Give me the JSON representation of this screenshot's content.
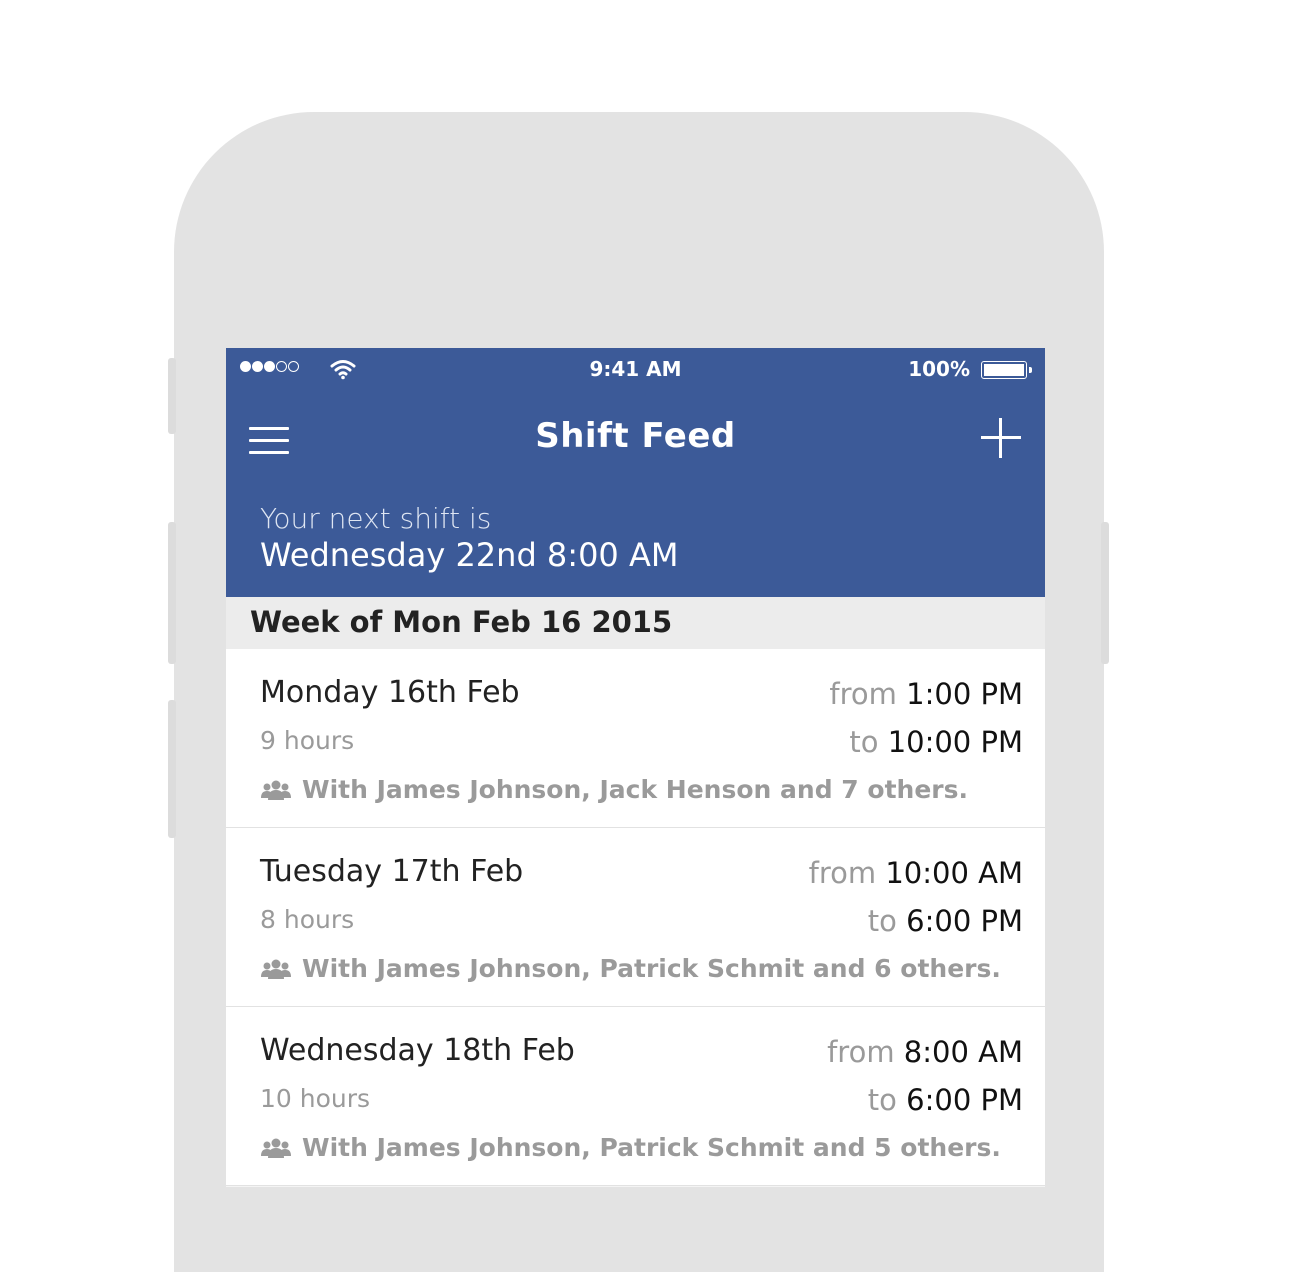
{
  "status_bar": {
    "signal_filled": 3,
    "signal_total": 5,
    "time": "9:41 AM",
    "battery_percent": "100%"
  },
  "nav": {
    "title": "Shift Feed",
    "menu_icon": "hamburger-menu-icon",
    "add_icon": "plus-icon"
  },
  "next_shift": {
    "label": "Your next shift is",
    "value": "Wednesday 22nd 8:00 AM"
  },
  "week": {
    "label": "Week of Mon Feb 16 2015"
  },
  "shifts": [
    {
      "day": "Monday 16th Feb",
      "hours": "9 hours",
      "from_label": "from",
      "from_time": "1:00 PM",
      "to_label": "to",
      "to_time": "10:00 PM",
      "with": "With James Johnson, Jack Henson and 7 others."
    },
    {
      "day": "Tuesday 17th Feb",
      "hours": "8 hours",
      "from_label": "from",
      "from_time": "10:00 AM",
      "to_label": "to",
      "to_time": "6:00 PM",
      "with": "With James Johnson, Patrick Schmit and 6 others."
    },
    {
      "day": "Wednesday 18th Feb",
      "hours": "10 hours",
      "from_label": "from",
      "from_time": "8:00 AM",
      "to_label": "to",
      "to_time": "6:00 PM",
      "with": "With James Johnson, Patrick Schmit and 5 others."
    }
  ],
  "colors": {
    "header": "#3c5a98",
    "phone_frame": "#e3e3e3",
    "muted_text": "#9a9a9a"
  }
}
